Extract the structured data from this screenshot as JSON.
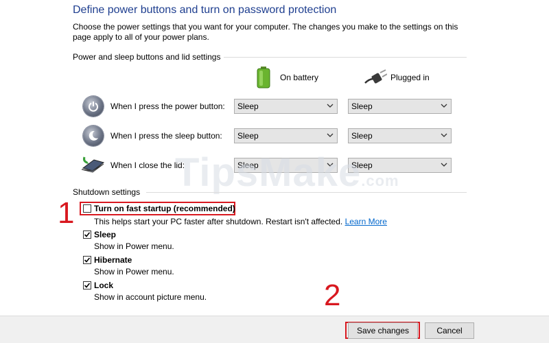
{
  "header": {
    "title": "Define power buttons and turn on password protection",
    "description": "Choose the power settings that you want for your computer. The changes you make to the settings on this page apply to all of your power plans."
  },
  "power_section": {
    "heading": "Power and sleep buttons and lid settings",
    "col_battery": "On battery",
    "col_plugged": "Plugged in",
    "rows": [
      {
        "label": "When I press the power button:",
        "icon": "power-button-icon",
        "battery": "Sleep",
        "plugged": "Sleep"
      },
      {
        "label": "When I press the sleep button:",
        "icon": "sleep-button-icon",
        "battery": "Sleep",
        "plugged": "Sleep"
      },
      {
        "label": "When I close the lid:",
        "icon": "laptop-lid-icon",
        "battery": "Sleep",
        "plugged": "Sleep"
      }
    ]
  },
  "shutdown_section": {
    "heading": "Shutdown settings",
    "options": [
      {
        "label": "Turn on fast startup (recommended)",
        "checked": false,
        "description": "This helps start your PC faster after shutdown. Restart isn't affected.",
        "link": "Learn More"
      },
      {
        "label": "Sleep",
        "checked": true,
        "description": "Show in Power menu."
      },
      {
        "label": "Hibernate",
        "checked": true,
        "description": "Show in Power menu."
      },
      {
        "label": "Lock",
        "checked": true,
        "description": "Show in account picture menu."
      }
    ]
  },
  "annotations": {
    "marker_1": "1",
    "marker_2": "2",
    "highlight_color": "#d8181f"
  },
  "watermark": {
    "text": "TipsMake",
    "suffix": ".com"
  },
  "footer": {
    "save_label": "Save changes",
    "cancel_label": "Cancel"
  }
}
